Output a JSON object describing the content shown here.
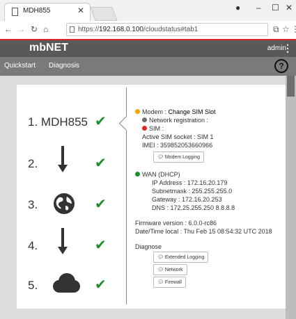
{
  "browser": {
    "tab_title": "MDH855",
    "url_prefix": "https://",
    "url_host": "192.168.0.100",
    "url_path": "/cloudstatus#tab1"
  },
  "app": {
    "brand": "mbNET",
    "user": "admin",
    "nav": [
      "Quickstart",
      "Diagnosis"
    ],
    "help": "?"
  },
  "steps": [
    {
      "number": "1.",
      "label": "MDH855"
    },
    {
      "number": "2."
    },
    {
      "number": "3."
    },
    {
      "number": "4."
    },
    {
      "number": "5."
    }
  ],
  "status_colors": {
    "modem": "#f5a400",
    "network": "#6e6e6e",
    "sim": "#e32424",
    "wan": "#1a8f2b",
    "check": "#1a8f2b"
  },
  "modem": {
    "label": "Modem : ",
    "action": "Change SIM Slot",
    "network_registration": "Network registration :",
    "sim": "SIM :",
    "active_sim": "Active SIM socket : SIM 1",
    "imei": "IMEI : 359852053660966",
    "logging_button": "Modem Logging"
  },
  "wan": {
    "label": "WAN (DHCP)",
    "ip": "IP Address : 172.16.20.179",
    "subnet": "Subnetmask : 255.255.255.0",
    "gateway": "Gateway : 172.16.20.253",
    "dns": "DNS : 172.25.255.250 8.8.8.8"
  },
  "firmware": "Firmware version : 6.0.0-rc86",
  "datetime": "Date/Time local : Thu Feb 15 08:54:32 UTC 2018",
  "diagnose": {
    "label": "Diagnose",
    "buttons": [
      "Extended Logging",
      "Network",
      "Firewall"
    ]
  }
}
